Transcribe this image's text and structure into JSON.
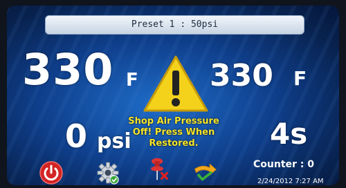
{
  "preset": {
    "label": "Preset 1 : 50psi"
  },
  "temps": {
    "left_value": "330",
    "left_unit": "F",
    "right_value": "330",
    "right_unit": "F"
  },
  "pressure": {
    "value": "0",
    "unit": "psi"
  },
  "timer": {
    "value": "4s"
  },
  "alert": {
    "line1": "Shop Air Pressure",
    "line2": "Off! Press When",
    "line3": "Restored."
  },
  "counter": {
    "label": "Counter : 0"
  },
  "datetime": {
    "text": "2/24/2012 7:27 AM"
  },
  "icons": [
    "power-icon",
    "gear-icon",
    "pin-icon",
    "arrow-icon",
    "warning-icon"
  ],
  "colors": {
    "alert_text": "#f6e52a",
    "warning_yellow": "#f4d21c",
    "power_red": "#d42424",
    "gear_green": "#3aa83a"
  }
}
